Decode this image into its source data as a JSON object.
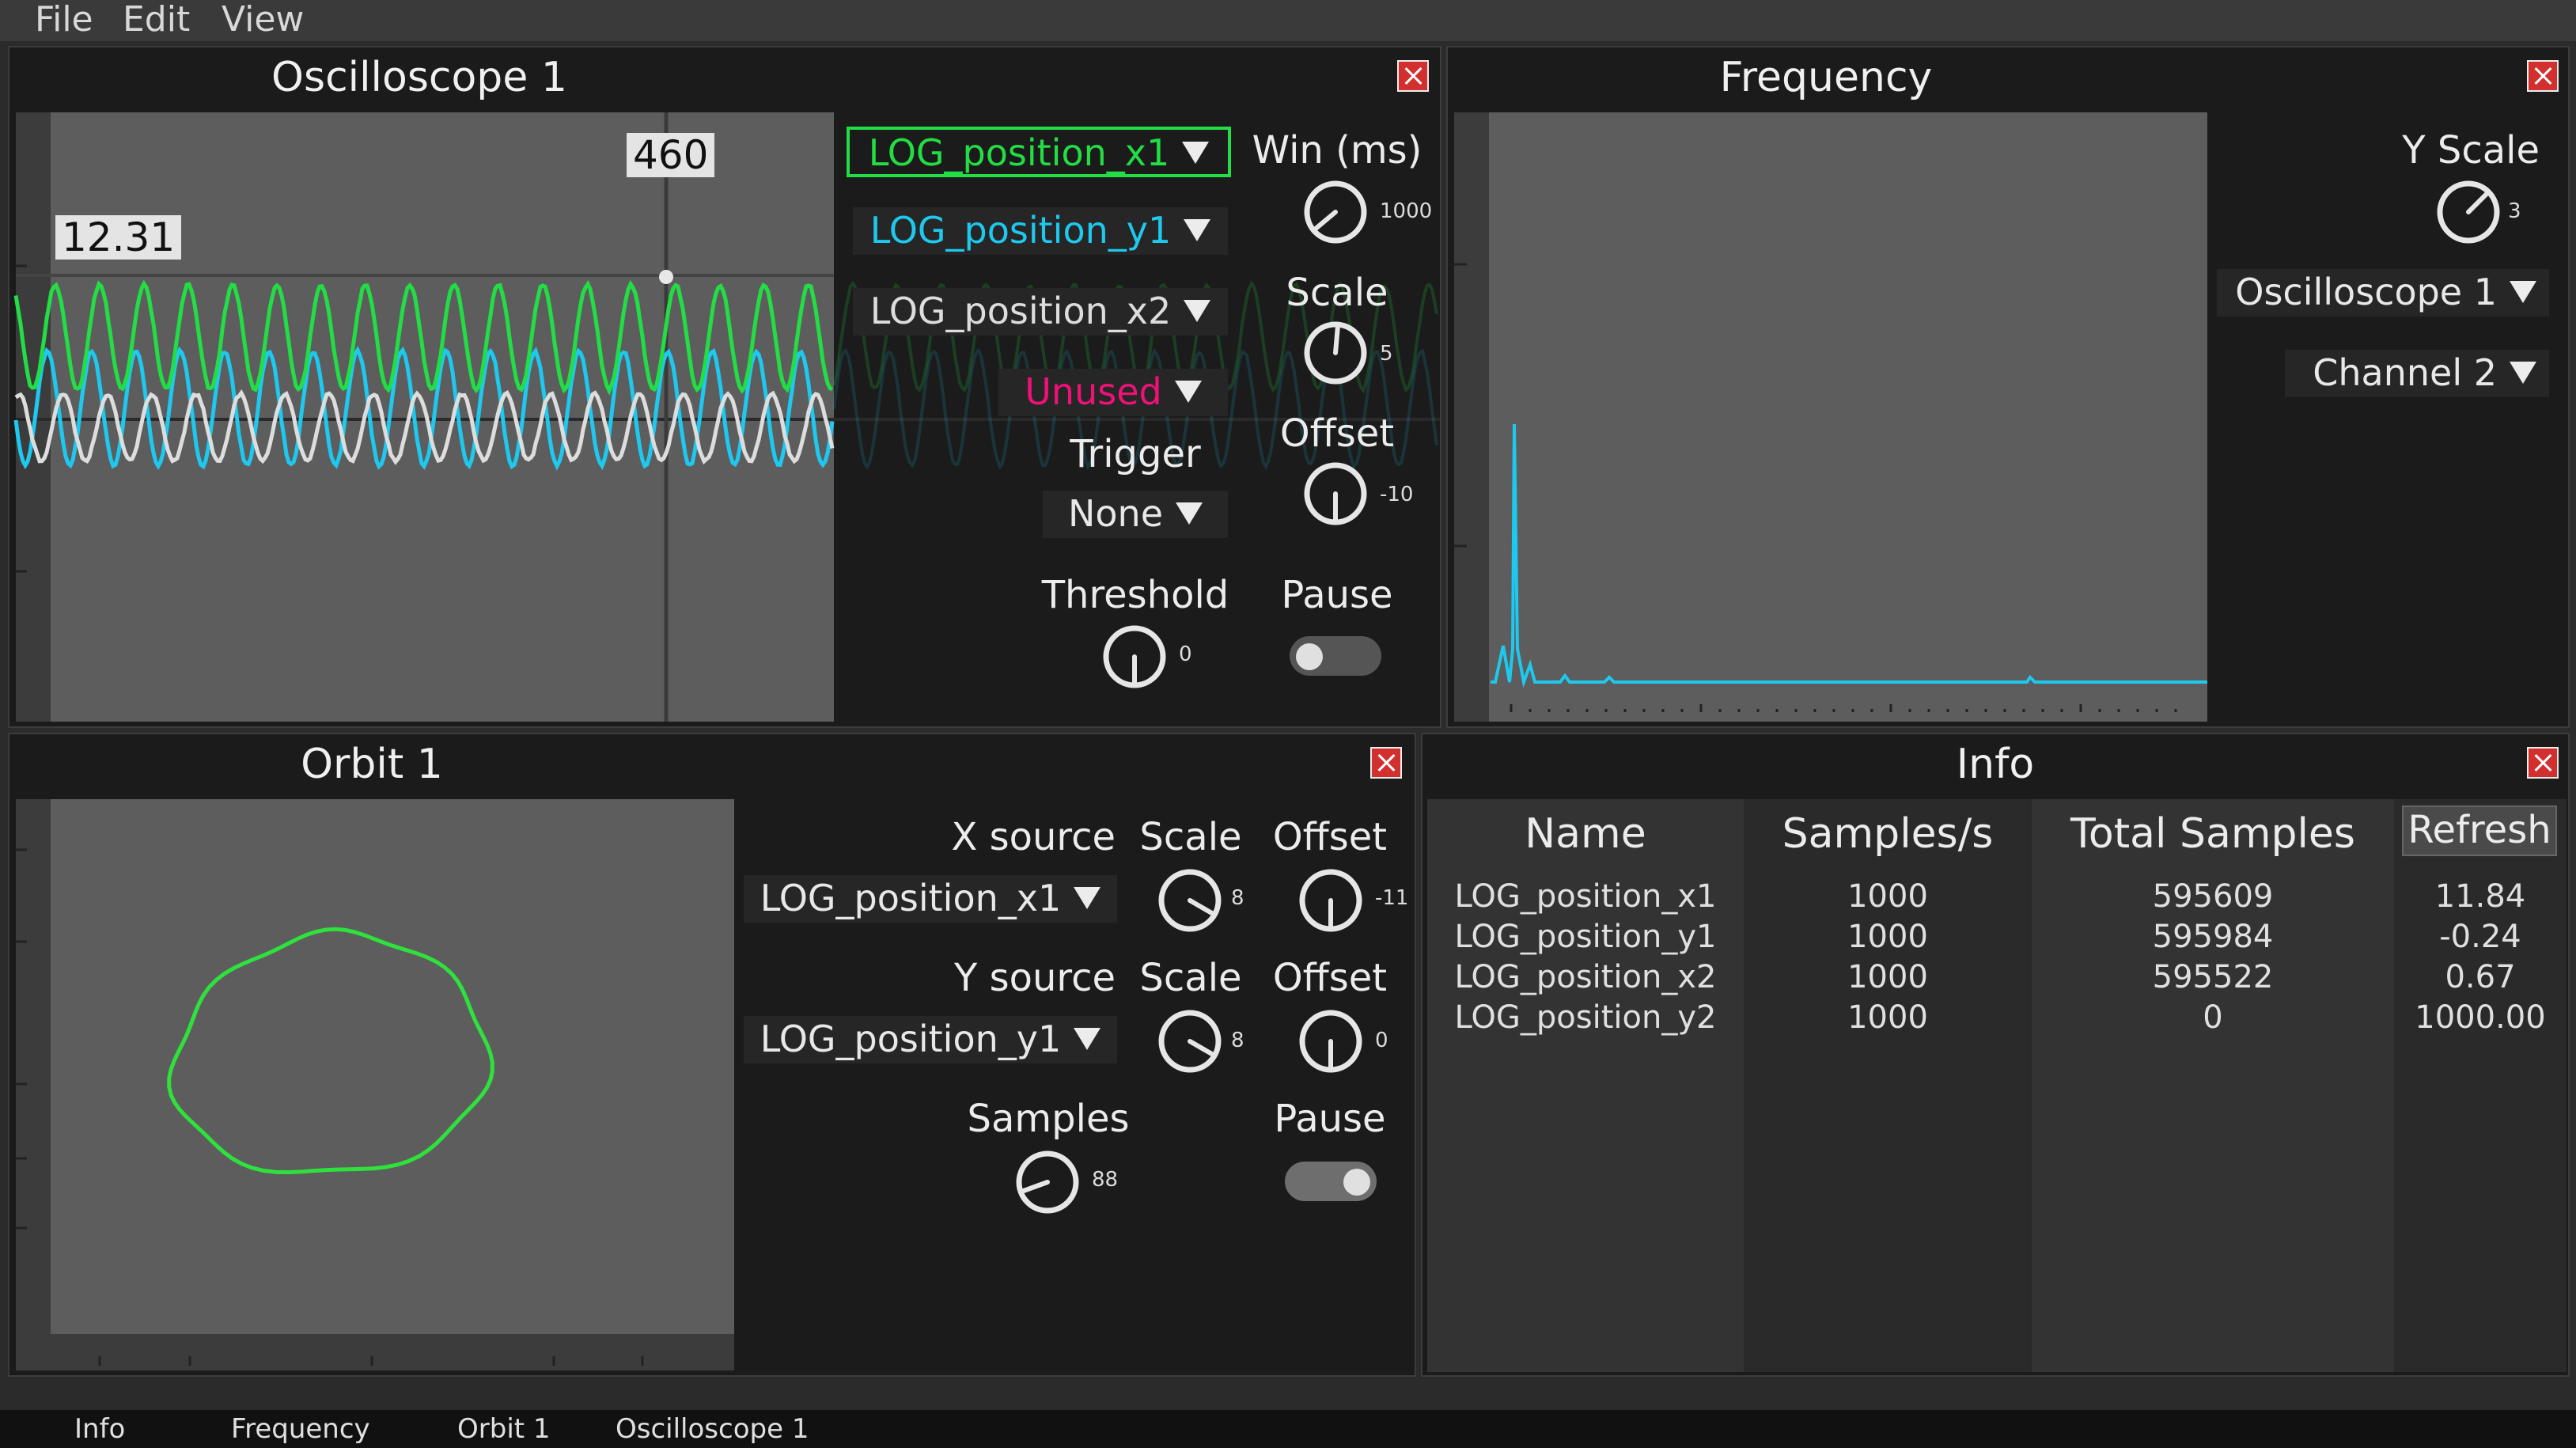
{
  "menu": {
    "file": "File",
    "edit": "Edit",
    "view": "View"
  },
  "scope": {
    "title": "Oscilloscope 1",
    "cursor_value": "12.31",
    "cursor_time": "460",
    "channels": [
      {
        "label": "LOG_position_x1",
        "color": "#22dd44"
      },
      {
        "label": "LOG_position_y1",
        "color": "#1ec8ee"
      },
      {
        "label": "LOG_position_x2",
        "color": "#dddddd"
      },
      {
        "label": "Unused",
        "color": "#ee1177"
      }
    ],
    "win_label": "Win (ms)",
    "win_value": "1000",
    "scale_label": "Scale",
    "scale_value": "5",
    "offset_label": "Offset",
    "offset_value": "-10",
    "trigger_label": "Trigger",
    "trigger_value": "None",
    "threshold_label": "Threshold",
    "threshold_value": "0",
    "pause_label": "Pause",
    "pause_on": false
  },
  "freq": {
    "title": "Frequency",
    "yscale_label": "Y Scale",
    "yscale_value": "3",
    "source": "Oscilloscope 1",
    "channel": "Channel 2",
    "color": "#1ec8ee"
  },
  "orbit": {
    "title": "Orbit 1",
    "xsource_label": "X source",
    "xsource": "LOG_position_x1",
    "ysource_label": "Y source",
    "ysource": "LOG_position_y1",
    "scale_label": "Scale",
    "offset_label": "Offset",
    "xscale": "8",
    "xoffset": "-11",
    "yscale": "8",
    "yoffset": "0",
    "samples_label": "Samples",
    "samples": "88",
    "pause_label": "Pause",
    "pause_on": true,
    "color": "#2ee13c"
  },
  "info": {
    "title": "Info",
    "headers": [
      "Name",
      "Samples/s",
      "Total Samples",
      "Refresh"
    ],
    "rows": [
      [
        "LOG_position_x1",
        "1000",
        "595609",
        "11.84"
      ],
      [
        "LOG_position_y1",
        "1000",
        "595984",
        "-0.24"
      ],
      [
        "LOG_position_x2",
        "1000",
        "595522",
        "0.67"
      ],
      [
        "LOG_position_y2",
        "1000",
        "0",
        "1000.00"
      ]
    ]
  },
  "tabs": [
    "Info",
    "Frequency",
    "Orbit 1",
    "Oscilloscope 1"
  ]
}
